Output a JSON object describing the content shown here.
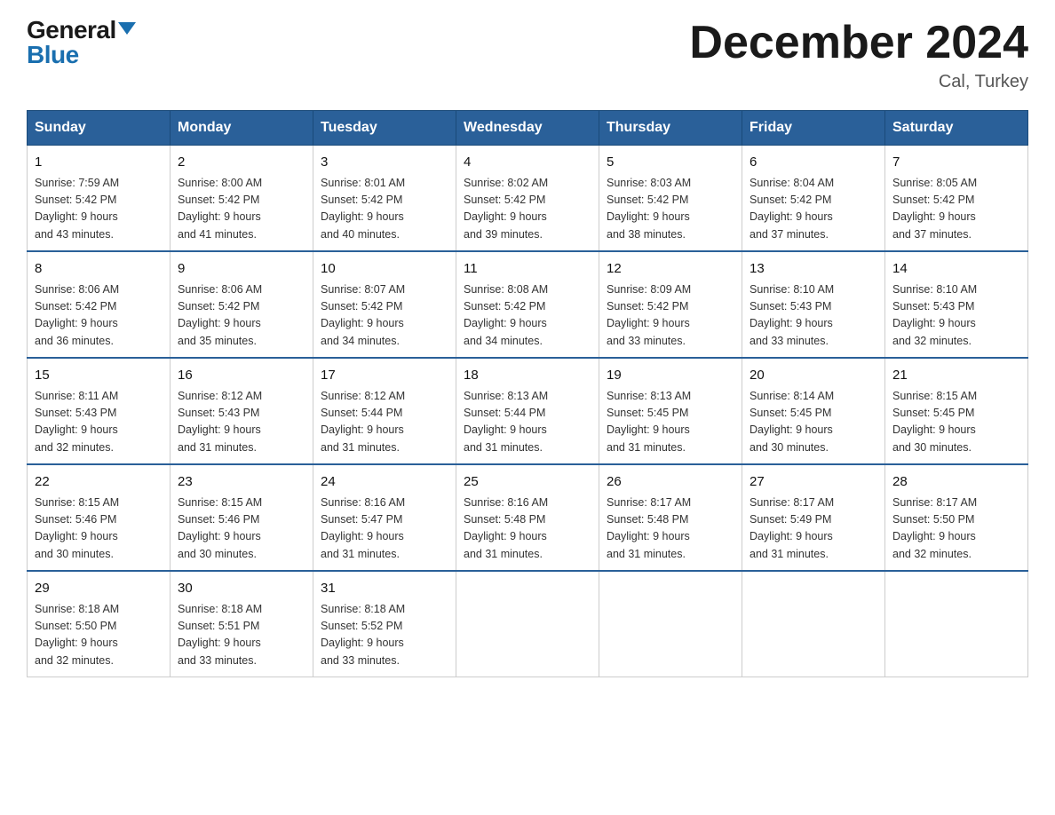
{
  "logo": {
    "general": "General",
    "blue": "Blue"
  },
  "title": "December 2024",
  "location": "Cal, Turkey",
  "days_of_week": [
    "Sunday",
    "Monday",
    "Tuesday",
    "Wednesday",
    "Thursday",
    "Friday",
    "Saturday"
  ],
  "weeks": [
    [
      {
        "day": "1",
        "sunrise": "7:59 AM",
        "sunset": "5:42 PM",
        "daylight": "9 hours and 43 minutes."
      },
      {
        "day": "2",
        "sunrise": "8:00 AM",
        "sunset": "5:42 PM",
        "daylight": "9 hours and 41 minutes."
      },
      {
        "day": "3",
        "sunrise": "8:01 AM",
        "sunset": "5:42 PM",
        "daylight": "9 hours and 40 minutes."
      },
      {
        "day": "4",
        "sunrise": "8:02 AM",
        "sunset": "5:42 PM",
        "daylight": "9 hours and 39 minutes."
      },
      {
        "day": "5",
        "sunrise": "8:03 AM",
        "sunset": "5:42 PM",
        "daylight": "9 hours and 38 minutes."
      },
      {
        "day": "6",
        "sunrise": "8:04 AM",
        "sunset": "5:42 PM",
        "daylight": "9 hours and 37 minutes."
      },
      {
        "day": "7",
        "sunrise": "8:05 AM",
        "sunset": "5:42 PM",
        "daylight": "9 hours and 37 minutes."
      }
    ],
    [
      {
        "day": "8",
        "sunrise": "8:06 AM",
        "sunset": "5:42 PM",
        "daylight": "9 hours and 36 minutes."
      },
      {
        "day": "9",
        "sunrise": "8:06 AM",
        "sunset": "5:42 PM",
        "daylight": "9 hours and 35 minutes."
      },
      {
        "day": "10",
        "sunrise": "8:07 AM",
        "sunset": "5:42 PM",
        "daylight": "9 hours and 34 minutes."
      },
      {
        "day": "11",
        "sunrise": "8:08 AM",
        "sunset": "5:42 PM",
        "daylight": "9 hours and 34 minutes."
      },
      {
        "day": "12",
        "sunrise": "8:09 AM",
        "sunset": "5:42 PM",
        "daylight": "9 hours and 33 minutes."
      },
      {
        "day": "13",
        "sunrise": "8:10 AM",
        "sunset": "5:43 PM",
        "daylight": "9 hours and 33 minutes."
      },
      {
        "day": "14",
        "sunrise": "8:10 AM",
        "sunset": "5:43 PM",
        "daylight": "9 hours and 32 minutes."
      }
    ],
    [
      {
        "day": "15",
        "sunrise": "8:11 AM",
        "sunset": "5:43 PM",
        "daylight": "9 hours and 32 minutes."
      },
      {
        "day": "16",
        "sunrise": "8:12 AM",
        "sunset": "5:43 PM",
        "daylight": "9 hours and 31 minutes."
      },
      {
        "day": "17",
        "sunrise": "8:12 AM",
        "sunset": "5:44 PM",
        "daylight": "9 hours and 31 minutes."
      },
      {
        "day": "18",
        "sunrise": "8:13 AM",
        "sunset": "5:44 PM",
        "daylight": "9 hours and 31 minutes."
      },
      {
        "day": "19",
        "sunrise": "8:13 AM",
        "sunset": "5:45 PM",
        "daylight": "9 hours and 31 minutes."
      },
      {
        "day": "20",
        "sunrise": "8:14 AM",
        "sunset": "5:45 PM",
        "daylight": "9 hours and 30 minutes."
      },
      {
        "day": "21",
        "sunrise": "8:15 AM",
        "sunset": "5:45 PM",
        "daylight": "9 hours and 30 minutes."
      }
    ],
    [
      {
        "day": "22",
        "sunrise": "8:15 AM",
        "sunset": "5:46 PM",
        "daylight": "9 hours and 30 minutes."
      },
      {
        "day": "23",
        "sunrise": "8:15 AM",
        "sunset": "5:46 PM",
        "daylight": "9 hours and 30 minutes."
      },
      {
        "day": "24",
        "sunrise": "8:16 AM",
        "sunset": "5:47 PM",
        "daylight": "9 hours and 31 minutes."
      },
      {
        "day": "25",
        "sunrise": "8:16 AM",
        "sunset": "5:48 PM",
        "daylight": "9 hours and 31 minutes."
      },
      {
        "day": "26",
        "sunrise": "8:17 AM",
        "sunset": "5:48 PM",
        "daylight": "9 hours and 31 minutes."
      },
      {
        "day": "27",
        "sunrise": "8:17 AM",
        "sunset": "5:49 PM",
        "daylight": "9 hours and 31 minutes."
      },
      {
        "day": "28",
        "sunrise": "8:17 AM",
        "sunset": "5:50 PM",
        "daylight": "9 hours and 32 minutes."
      }
    ],
    [
      {
        "day": "29",
        "sunrise": "8:18 AM",
        "sunset": "5:50 PM",
        "daylight": "9 hours and 32 minutes."
      },
      {
        "day": "30",
        "sunrise": "8:18 AM",
        "sunset": "5:51 PM",
        "daylight": "9 hours and 33 minutes."
      },
      {
        "day": "31",
        "sunrise": "8:18 AM",
        "sunset": "5:52 PM",
        "daylight": "9 hours and 33 minutes."
      },
      null,
      null,
      null,
      null
    ]
  ],
  "labels": {
    "sunrise": "Sunrise:",
    "sunset": "Sunset:",
    "daylight": "Daylight:"
  }
}
